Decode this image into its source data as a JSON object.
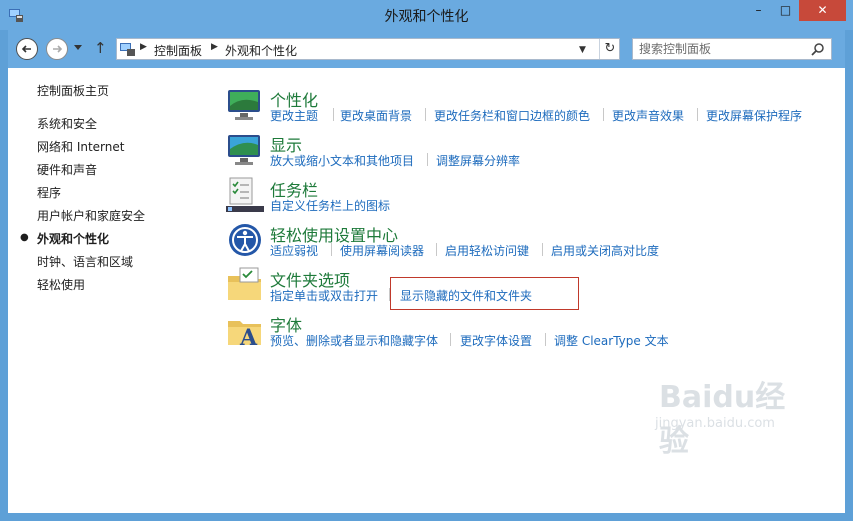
{
  "window": {
    "title": "外观和个性化",
    "controls": {
      "minimize": "–",
      "maximize": "□",
      "close": "✕"
    }
  },
  "address": {
    "crumbs": [
      "控制面板",
      "外观和个性化"
    ],
    "search_placeholder": "搜索控制面板"
  },
  "sidebar": {
    "items": [
      {
        "label": "控制面板主页"
      },
      {
        "label": "系统和安全"
      },
      {
        "label": "网络和 Internet"
      },
      {
        "label": "硬件和声音"
      },
      {
        "label": "程序"
      },
      {
        "label": "用户帐户和家庭安全"
      },
      {
        "label": "外观和个性化",
        "current": true
      },
      {
        "label": "时钟、语言和区域"
      },
      {
        "label": "轻松使用"
      }
    ]
  },
  "categories": [
    {
      "title": "个性化",
      "icon": "personalization-icon",
      "links": [
        "更改主题",
        "更改桌面背景",
        "更改任务栏和窗口边框的颜色",
        "更改声音效果",
        "更改屏幕保护程序"
      ]
    },
    {
      "title": "显示",
      "icon": "display-icon",
      "links": [
        "放大或缩小文本和其他项目",
        "调整屏幕分辨率"
      ]
    },
    {
      "title": "任务栏",
      "icon": "taskbar-icon",
      "links": [
        "自定义任务栏上的图标"
      ]
    },
    {
      "title": "轻松使用设置中心",
      "icon": "ease-of-access-icon",
      "links": [
        "适应弱视",
        "使用屏幕阅读器",
        "启用轻松访问键",
        "启用或关闭高对比度"
      ]
    },
    {
      "title": "文件夹选项",
      "icon": "folder-options-icon",
      "links": [
        "指定单击或双击打开",
        "显示隐藏的文件和文件夹"
      ]
    },
    {
      "title": "字体",
      "icon": "fonts-icon",
      "links": [
        "预览、删除或者显示和隐藏字体",
        "更改字体设置",
        "调整 ClearType 文本"
      ]
    }
  ],
  "watermark": {
    "text": "Baidu经验",
    "sub": "jingyan.baidu.com"
  },
  "colors": {
    "title_bar": "#6aaae0",
    "category_title": "#1e7a3a",
    "link": "#1d6bbd",
    "highlight": "#c0392b"
  }
}
